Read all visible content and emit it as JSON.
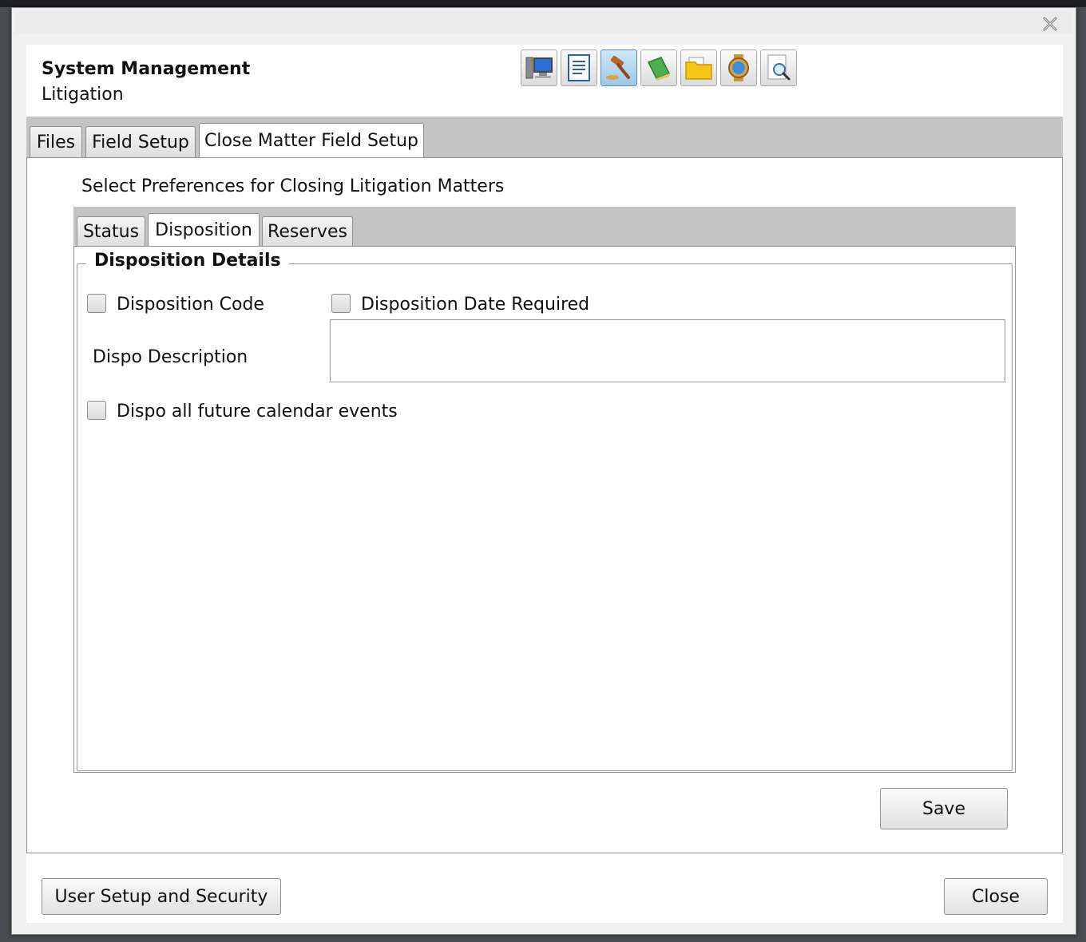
{
  "header": {
    "title": "System Management",
    "subtitle": "Litigation"
  },
  "toolbar": {
    "icons": [
      "computer-icon",
      "document-icon",
      "gavel-icon",
      "book-icon",
      "folder-icon",
      "watch-icon",
      "search-document-icon"
    ],
    "active_index": 2
  },
  "main_tabs": [
    "Files",
    "Field Setup",
    "Close Matter Field Setup"
  ],
  "main_active": "Close Matter Field Setup",
  "prefs_label": "Select Preferences for Closing Litigation Matters",
  "sub_tabs": [
    "Status",
    "Disposition",
    "Reserves"
  ],
  "sub_active": "Disposition",
  "disposition": {
    "legend": "Disposition Details",
    "disposition_code": {
      "label": "Disposition Code",
      "checked": false
    },
    "disposition_date_required": {
      "label": "Disposition Date Required",
      "checked": false
    },
    "dispo_description_label": "Dispo Description",
    "dispo_description_value": "",
    "dispo_future_events": {
      "label": "Dispo all future calendar events",
      "checked": false
    }
  },
  "buttons": {
    "save": "Save",
    "user_setup": "User Setup and Security",
    "close": "Close"
  },
  "colors": {
    "tab_band": "#c4c4c4",
    "active_tool": "#9cc9e6"
  }
}
